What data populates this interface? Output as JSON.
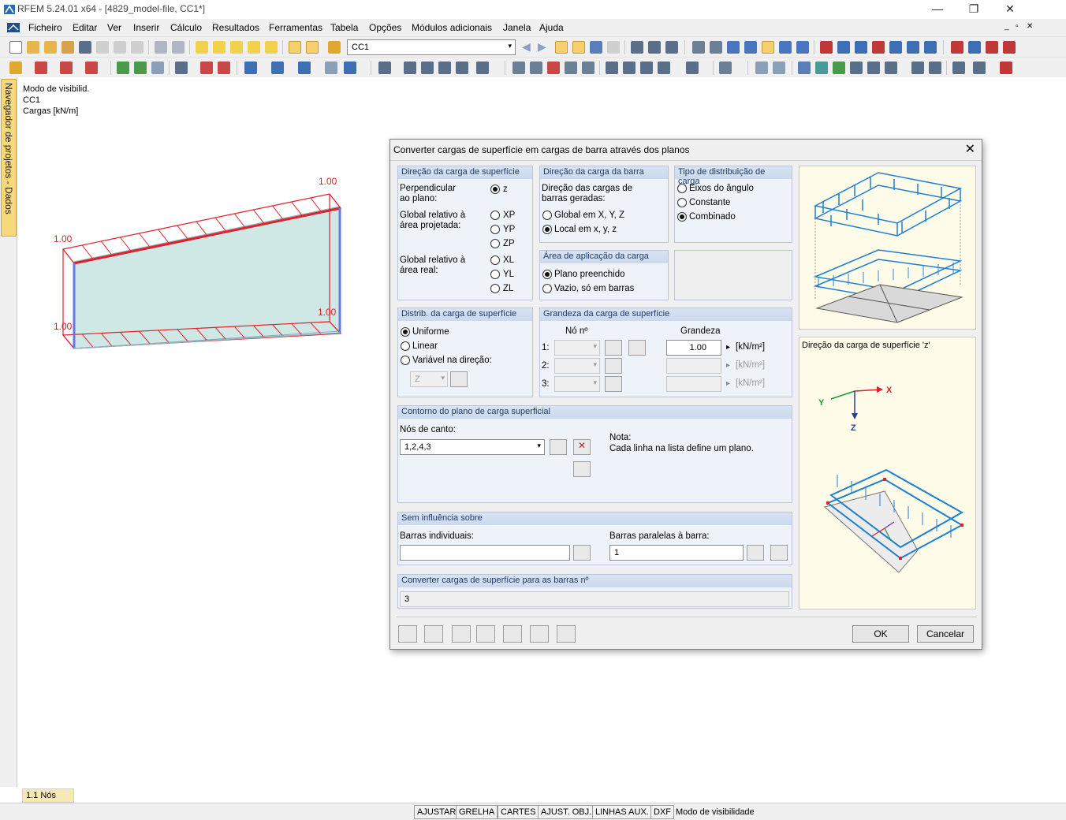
{
  "window": {
    "title": "RFEM 5.24.01 x64 - [4829_model-file, CC1*]",
    "minimize": "—",
    "restore": "❐",
    "close": "✕"
  },
  "menu": [
    "Ficheiro",
    "Editar",
    "Ver",
    "Inserir",
    "Cálculo",
    "Resultados",
    "Ferramentas",
    "Tabela",
    "Opções",
    "Módulos adicionais",
    "Janela",
    "Ajuda"
  ],
  "toolbar": {
    "load_case": "CC1"
  },
  "navigator": {
    "tab_label": "Navegador de projetos - Dados"
  },
  "workspace": {
    "info": [
      "Modo de visibilid.",
      "CC1",
      "Cargas [kN/m]"
    ],
    "load_labels": [
      "1.00",
      "1.00",
      "1.00",
      "1.00"
    ]
  },
  "dialog": {
    "title": "Converter cargas de superfície em cargas de barra através dos planos",
    "surface_load_direction": {
      "header": "Direção da carga de superfície",
      "perpendicular_label": "Perpendicular ao plano:",
      "global_projected_label": "Global relativo à área projetada:",
      "global_real_label": "Global relativo à área real:",
      "options": [
        "z",
        "XP",
        "YP",
        "ZP",
        "XL",
        "YL",
        "ZL"
      ],
      "selected": "z"
    },
    "member_load_direction": {
      "header": "Direção da carga da barra",
      "subtitle": "Direção das cargas de barras geradas:",
      "options": [
        "Global em X, Y, Z",
        "Local em x, y, z"
      ],
      "selected": "Local em x, y, z"
    },
    "distribution_type": {
      "header": "Tipo de distribuição de carga",
      "options": [
        "Eixos do ângulo",
        "Constante",
        "Combinado"
      ],
      "selected": "Combinado"
    },
    "application_area": {
      "header": "Área de aplicação da carga",
      "options": [
        "Plano preenchido",
        "Vazio, só em barras"
      ],
      "selected": "Plano preenchido"
    },
    "surface_distribution": {
      "header": "Distrib. da carga de superfície",
      "options": [
        "Uniforme",
        "Linear",
        "Variável na direção:"
      ],
      "selected": "Uniforme",
      "direction_value": "Z"
    },
    "magnitude": {
      "header": "Grandeza da carga de superfície",
      "col_node": "Nó nº",
      "col_value": "Grandeza",
      "rows": [
        {
          "label": "1:",
          "value": "1.00",
          "unit": "[kN/m²]"
        },
        {
          "label": "2:",
          "value": "",
          "unit": "[kN/m²]"
        },
        {
          "label": "3:",
          "value": "",
          "unit": "[kN/m²]"
        }
      ]
    },
    "contour": {
      "header": "Contorno do plano de carga superficial",
      "corner_nodes_label": "Nós de canto:",
      "corner_nodes_value": "1,2,4,3",
      "note_title": "Nota:",
      "note_text": "Cada linha na lista define um plano."
    },
    "no_influence": {
      "header": "Sem influência sobre",
      "individual_label": "Barras individuais:",
      "individual_value": "",
      "parallel_label": "Barras paralelas à barra:",
      "parallel_value": "1"
    },
    "convert": {
      "header": "Converter cargas de superfície para as barras nº",
      "value": "3"
    },
    "preview_caption": "Direção da carga de superfície 'z'",
    "axes": {
      "x": "X",
      "y": "Y",
      "z": "Z"
    },
    "footer": {
      "ok": "OK",
      "cancel": "Cancelar"
    }
  },
  "bottom": {
    "nodes_tab": "1.1 Nós",
    "status_buttons": [
      "AJUSTAR",
      "GRELHA",
      "CARTES",
      "AJUST. OBJ.",
      "LINHAS AUX.",
      "DXF"
    ],
    "status_text": "Modo de visibilidade"
  },
  "colors": {
    "accent": "#2f6fb5",
    "load_red": "#e0202a",
    "panel_fill": "#cfe8e6",
    "nav_tab": "#f6d97a",
    "model_blue": "#2b8ad1"
  }
}
